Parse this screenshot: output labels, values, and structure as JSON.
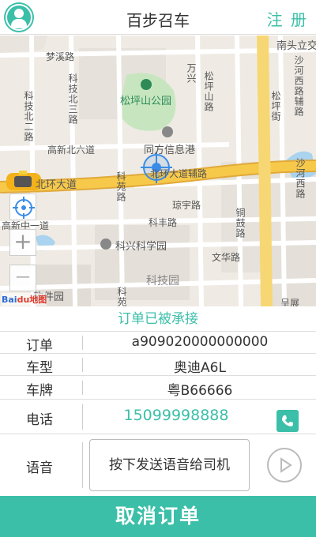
{
  "header": {
    "title": "百步召车",
    "register_label": "注 册"
  },
  "map": {
    "labels": {
      "mengxi_road": "梦溪路",
      "kejibei_road": "科技北二路",
      "keji_road3": "科技北三路",
      "wanxiang": "万兴",
      "songping_mountain_road": "松坪山路",
      "songping_park": "松坪山公园",
      "songping_street": "松坪街",
      "nantou": "南头立交",
      "shahe_west_road": "沙河西路辅路",
      "gaoxin_north6": "高新北六道",
      "tongfang": "同方信息港",
      "beihuan_road": "北环大道",
      "beihuan_aux": "北环大道辅路",
      "keyuan_road": "科苑路",
      "qiongyu_road": "琼宇路",
      "shahe_west2": "沙河西路",
      "gaoxin_zhong": "高新中一道",
      "kefeng_road": "科丰路",
      "tonggu_road": "铜鼓路",
      "kexing_park": "科兴科学园",
      "wenhua_road": "文华路",
      "kejiyuan": "科技园",
      "ruanjianyuan": "软件园",
      "kefu": "科苑",
      "chengwu": "呈展"
    },
    "zoom_in": "+",
    "zoom_out": "—",
    "baidu_logo": "Bai",
    "baidu_logo2": "du地图"
  },
  "status": {
    "text": "订单已被承接"
  },
  "order": {
    "order_label": "订单",
    "order_value": "a909020000000000",
    "model_label": "车型",
    "model_value": "奥迪A6L",
    "plate_label": "车牌",
    "plate_value": "粤B66666",
    "phone_label": "电话",
    "phone_value": "15099998888",
    "voice_label": "语音",
    "voice_button": "按下发送语音给司机"
  },
  "cancel_button": "取消订单",
  "colors": {
    "accent": "#3bbfa8",
    "main_road": "#f7c94a",
    "park": "#c7e6c0",
    "water": "#a9d3ee"
  }
}
